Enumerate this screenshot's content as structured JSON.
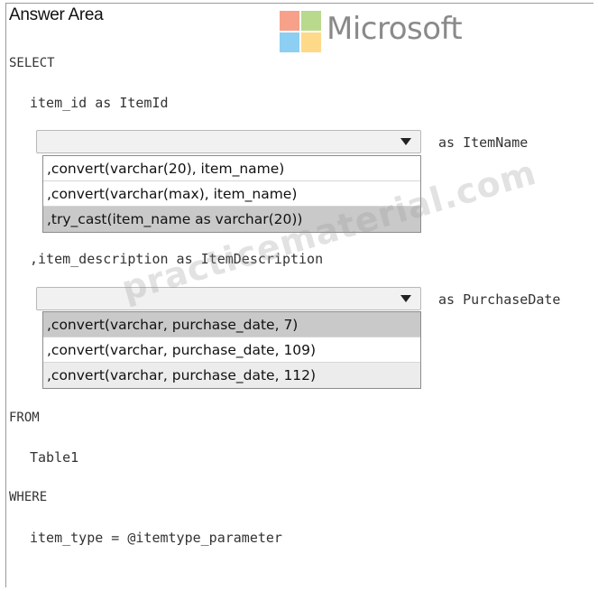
{
  "header": {
    "title": "Answer Area",
    "brand": "Microsoft",
    "logo_colors": [
      "#f25022",
      "#7fba00",
      "#00a4ef",
      "#ffb900"
    ]
  },
  "query": {
    "select_kw": "SELECT",
    "line_item_id": "item_id as ItemId",
    "dropdown1": {
      "selected": "",
      "suffix": "as ItemName",
      "options": [
        ",convert(varchar(20), item_name)",
        ",convert(varchar(max), item_name)",
        ",try_cast(item_name as varchar(20))"
      ]
    },
    "line_item_description": ",item_description as ItemDescription",
    "dropdown2": {
      "selected": "",
      "suffix": "as PurchaseDate",
      "options": [
        ",convert(varchar, purchase_date, 7)",
        ",convert(varchar, purchase_date, 109)",
        ",convert(varchar, purchase_date, 112)"
      ]
    },
    "from_kw": "FROM",
    "table": "Table1",
    "where_kw": "WHERE",
    "condition": "item_type = @itemtype_parameter"
  },
  "watermark": "practicematerial.com"
}
